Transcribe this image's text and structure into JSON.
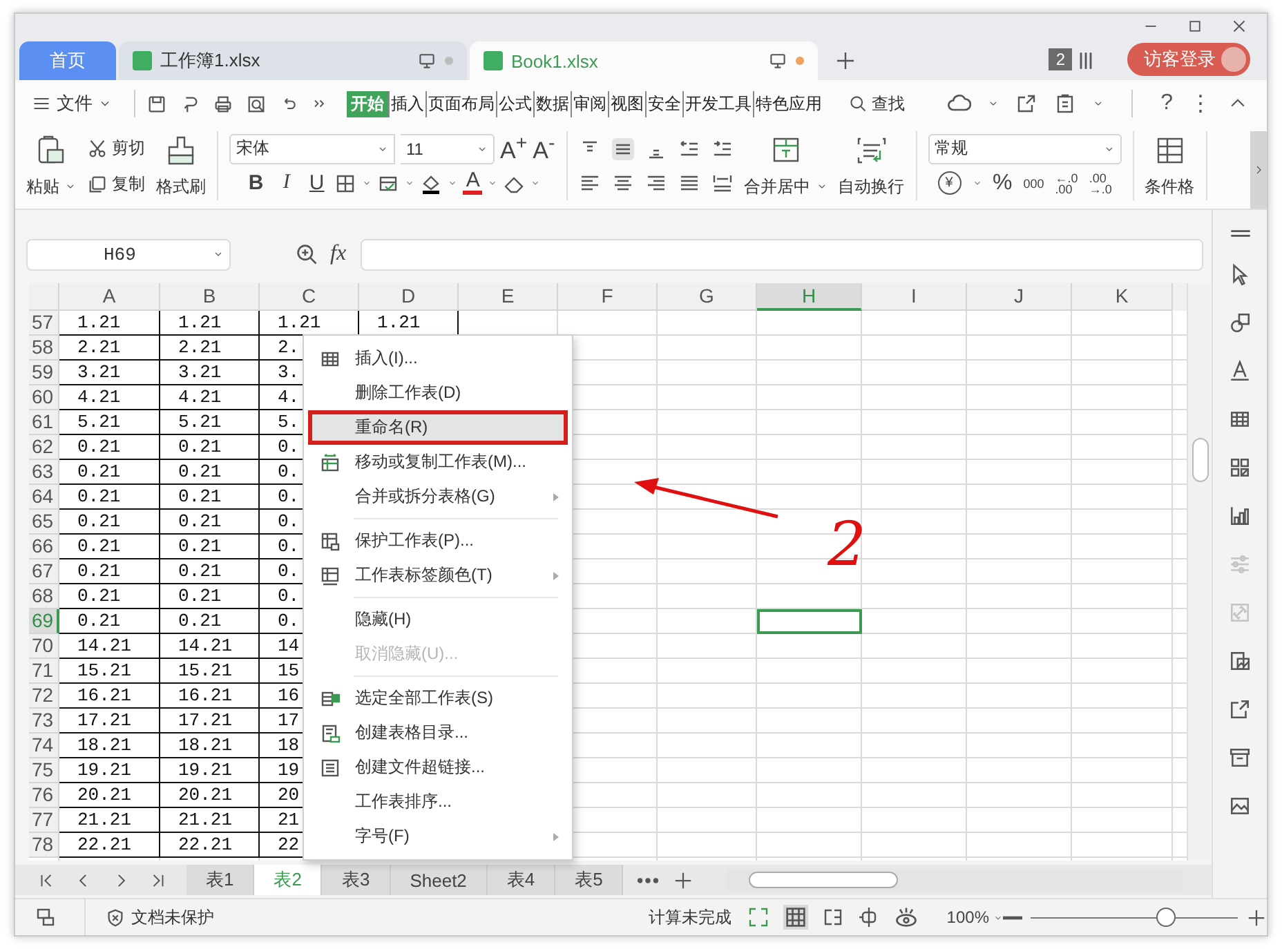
{
  "tabs": [
    {
      "label": "首页",
      "kind": "home",
      "selected": false
    },
    {
      "label": "工作簿1.xlsx",
      "kind": "file",
      "selected": false,
      "modified": false
    },
    {
      "label": "Book1.xlsx",
      "kind": "file",
      "selected": true,
      "modified": true
    }
  ],
  "window_badge": "2",
  "login": "访客登录",
  "menu": {
    "file": "文件",
    "ribbon_tabs": [
      {
        "label": "开始",
        "selected": true
      },
      {
        "label": "插入",
        "selected": false
      },
      {
        "label": "页面布局",
        "selected": false
      },
      {
        "label": "公式",
        "selected": false
      },
      {
        "label": "数据",
        "selected": false
      },
      {
        "label": "审阅",
        "selected": false
      },
      {
        "label": "视图",
        "selected": false
      },
      {
        "label": "安全",
        "selected": false
      },
      {
        "label": "开发工具",
        "selected": false
      },
      {
        "label": "特色应用",
        "selected": false
      }
    ],
    "search": "查找",
    "help": "?",
    "more": "⋮"
  },
  "ribbon": {
    "paste": "粘贴",
    "cut": "剪切",
    "copy": "复制",
    "format_painter": "格式刷",
    "font_name": "宋体",
    "font_size": "11",
    "grow": "A$^{+}$",
    "shrink": "A$^{-}$",
    "bold": "B",
    "italic": "I",
    "underline": "U",
    "font_color": "A",
    "merge": "合并居中",
    "wrap": "自动换行",
    "number_format": "常规",
    "currency": "¥",
    "percent": "%",
    "thousands": "000",
    "add_decimal": [
      "←.0",
      ".00"
    ],
    "remove_decimal": [
      ".00",
      "→.0"
    ],
    "conditional": "条件格"
  },
  "formula_bar": {
    "cell": "H69",
    "fx": "fx"
  },
  "grid": {
    "columns": [
      {
        "label": "A",
        "selected": false
      },
      {
        "label": "B",
        "selected": false
      },
      {
        "label": "C",
        "selected": false
      },
      {
        "label": "D",
        "selected": false
      },
      {
        "label": "E",
        "selected": false
      },
      {
        "label": "F",
        "selected": false
      },
      {
        "label": "G",
        "selected": false
      },
      {
        "label": "H",
        "selected": true
      },
      {
        "label": "I",
        "selected": false
      },
      {
        "label": "J",
        "selected": false
      },
      {
        "label": "K",
        "selected": false
      }
    ],
    "rows": [
      {
        "label": "57",
        "selected": false,
        "cells": [
          "1.21",
          "1.21",
          "1.21",
          "1.21"
        ]
      },
      {
        "label": "58",
        "selected": false,
        "cells": [
          "2.21",
          "2.21",
          "2."
        ]
      },
      {
        "label": "59",
        "selected": false,
        "cells": [
          "3.21",
          "3.21",
          "3."
        ]
      },
      {
        "label": "60",
        "selected": false,
        "cells": [
          "4.21",
          "4.21",
          "4."
        ]
      },
      {
        "label": "61",
        "selected": false,
        "cells": [
          "5.21",
          "5.21",
          "5."
        ]
      },
      {
        "label": "62",
        "selected": false,
        "cells": [
          "0.21",
          "0.21",
          "0."
        ]
      },
      {
        "label": "63",
        "selected": false,
        "cells": [
          "0.21",
          "0.21",
          "0."
        ]
      },
      {
        "label": "64",
        "selected": false,
        "cells": [
          "0.21",
          "0.21",
          "0."
        ]
      },
      {
        "label": "65",
        "selected": false,
        "cells": [
          "0.21",
          "0.21",
          "0."
        ]
      },
      {
        "label": "66",
        "selected": false,
        "cells": [
          "0.21",
          "0.21",
          "0."
        ]
      },
      {
        "label": "67",
        "selected": false,
        "cells": [
          "0.21",
          "0.21",
          "0."
        ]
      },
      {
        "label": "68",
        "selected": false,
        "cells": [
          "0.21",
          "0.21",
          "0."
        ]
      },
      {
        "label": "69",
        "selected": true,
        "cells": [
          "0.21",
          "0.21",
          "0."
        ]
      },
      {
        "label": "70",
        "selected": false,
        "cells": [
          "14.21",
          "14.21",
          "14"
        ]
      },
      {
        "label": "71",
        "selected": false,
        "cells": [
          "15.21",
          "15.21",
          "15"
        ]
      },
      {
        "label": "72",
        "selected": false,
        "cells": [
          "16.21",
          "16.21",
          "16"
        ]
      },
      {
        "label": "73",
        "selected": false,
        "cells": [
          "17.21",
          "17.21",
          "17"
        ]
      },
      {
        "label": "74",
        "selected": false,
        "cells": [
          "18.21",
          "18.21",
          "18"
        ]
      },
      {
        "label": "75",
        "selected": false,
        "cells": [
          "19.21",
          "19.21",
          "19"
        ]
      },
      {
        "label": "76",
        "selected": false,
        "cells": [
          "20.21",
          "20.21",
          "20"
        ]
      },
      {
        "label": "77",
        "selected": false,
        "cells": [
          "21.21",
          "21.21",
          "21"
        ]
      },
      {
        "label": "78",
        "selected": false,
        "cells": [
          "22.21",
          "22.21",
          "22"
        ]
      }
    ]
  },
  "context_menu": [
    {
      "kind": "item",
      "label": "插入(I)...",
      "submenu": false,
      "disabled": false,
      "selected": false
    },
    {
      "kind": "item",
      "label": "删除工作表(D)",
      "submenu": false,
      "disabled": false,
      "selected": false
    },
    {
      "kind": "item",
      "label": "重命名(R)",
      "submenu": false,
      "disabled": false,
      "selected": true
    },
    {
      "kind": "item",
      "label": "移动或复制工作表(M)...",
      "submenu": false,
      "disabled": false,
      "selected": false
    },
    {
      "kind": "item",
      "label": "合并或拆分表格(G)",
      "submenu": true,
      "disabled": false,
      "selected": false
    },
    {
      "kind": "separator"
    },
    {
      "kind": "item",
      "label": "保护工作表(P)...",
      "submenu": false,
      "disabled": false,
      "selected": false
    },
    {
      "kind": "item",
      "label": "工作表标签颜色(T)",
      "submenu": true,
      "disabled": false,
      "selected": false
    },
    {
      "kind": "separator"
    },
    {
      "kind": "item",
      "label": "隐藏(H)",
      "submenu": false,
      "disabled": false,
      "selected": false
    },
    {
      "kind": "item",
      "label": "取消隐藏(U)...",
      "submenu": false,
      "disabled": true,
      "selected": false
    },
    {
      "kind": "separator"
    },
    {
      "kind": "item",
      "label": "选定全部工作表(S)",
      "submenu": false,
      "disabled": false,
      "selected": false
    },
    {
      "kind": "item",
      "label": "创建表格目录...",
      "submenu": false,
      "disabled": false,
      "selected": false
    },
    {
      "kind": "item",
      "label": "创建文件超链接...",
      "submenu": false,
      "disabled": false,
      "selected": false
    },
    {
      "kind": "item",
      "label": "工作表排序...",
      "submenu": false,
      "disabled": false,
      "selected": false
    },
    {
      "kind": "item",
      "label": "字号(F)",
      "submenu": true,
      "disabled": false,
      "selected": false
    }
  ],
  "annotation": {
    "label": "2"
  },
  "sheet_tabs": [
    {
      "label": "表1",
      "selected": false
    },
    {
      "label": "表2",
      "selected": true
    },
    {
      "label": "表3",
      "selected": false
    },
    {
      "label": "Sheet2",
      "selected": false
    },
    {
      "label": "表4",
      "selected": false
    },
    {
      "label": "表5",
      "selected": false
    }
  ],
  "status_bar": {
    "protection": "文档未保护",
    "calc": "计算未完成",
    "zoom": "100%",
    "zoom_slider": {
      "level": 0.65
    }
  }
}
